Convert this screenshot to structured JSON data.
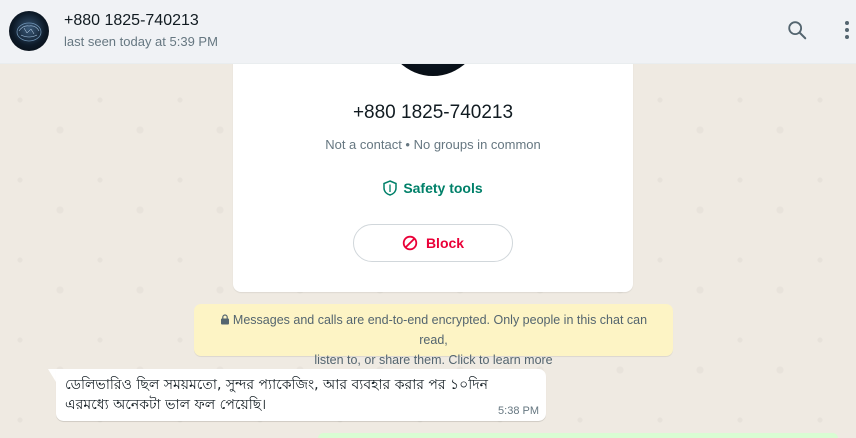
{
  "header": {
    "contact_name": "+880 1825-740213",
    "last_seen": "last seen today at 5:39 PM",
    "search_icon": "search-icon",
    "menu_icon": "menu-icon"
  },
  "info_card": {
    "phone_number": "+880 1825-740213",
    "subtitle": "Not a contact • No groups in common",
    "safety_label": "Safety tools",
    "block_label": "Block"
  },
  "encryption_notice": {
    "line1": "Messages and calls are end-to-end encrypted. Only people in this chat can read,",
    "line2": "listen to, or share them. Click to learn more"
  },
  "messages": [
    {
      "text_line1": "ডেলিভারিও ছিল সময়মতো, সুন্দর প্যাকেজিং, আর ব্যবহার করার পর ১০দিন",
      "text_line2": "এরমধ্যে অনেকটা ভাল ফল পেয়েছি।",
      "time": "5:38 PM",
      "direction": "incoming"
    }
  ],
  "colors": {
    "header_bg": "#f0f2f5",
    "chat_bg": "#efeae2",
    "accent_green": "#008069",
    "block_red": "#ea0038",
    "encryption_bg": "#fdf4c5",
    "outgoing_bubble": "#d9fdd3"
  }
}
